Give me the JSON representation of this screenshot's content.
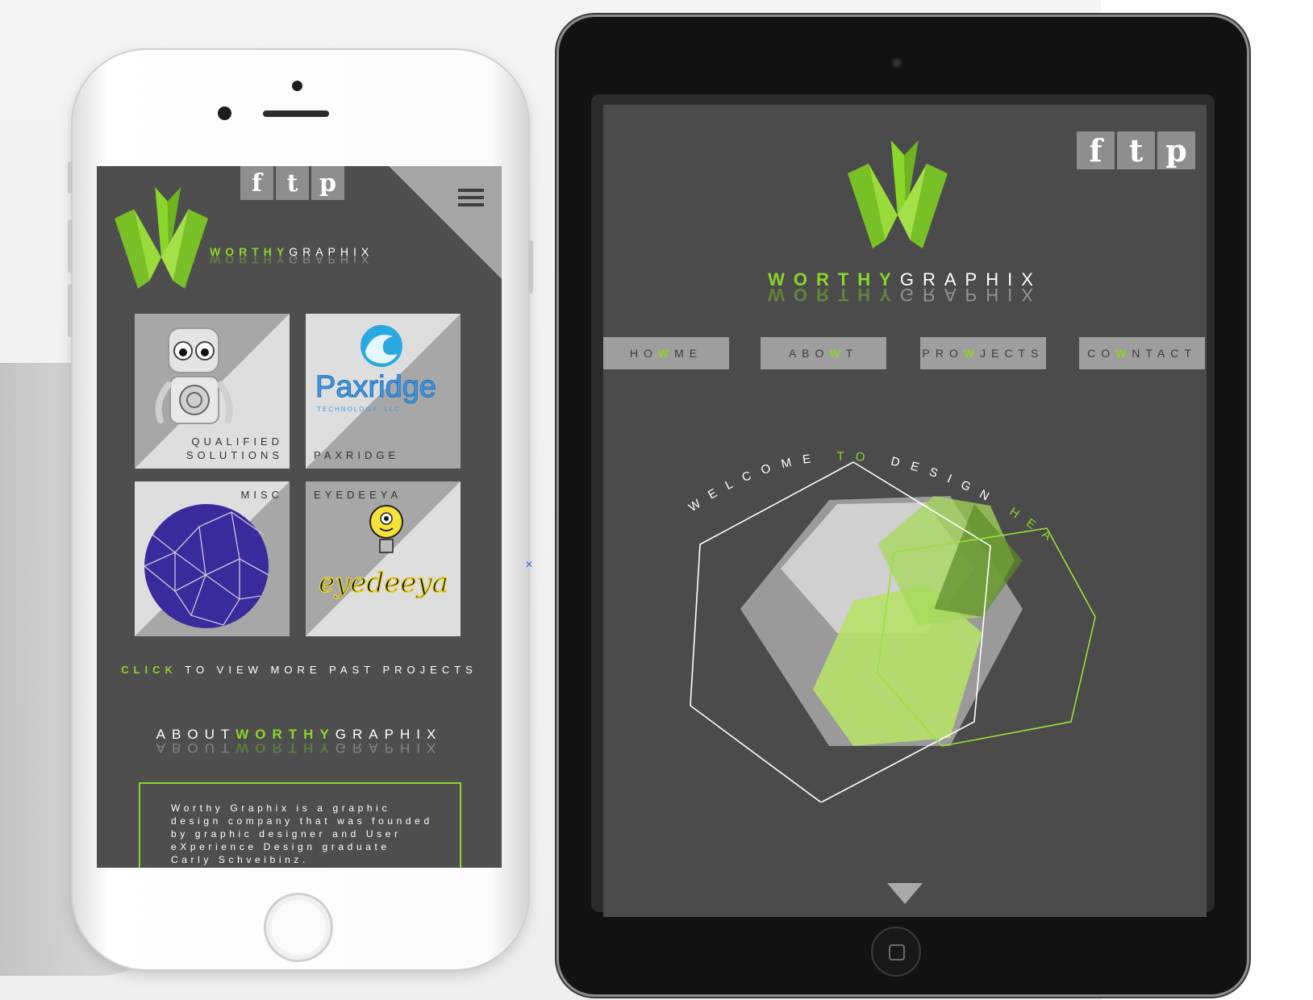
{
  "phone": {
    "social": [
      "f",
      "t",
      "p"
    ],
    "brand": {
      "highlight": "WORTHY",
      "rest": "GRAPHIX"
    },
    "projects": [
      {
        "label_line1": "QUALIFIED",
        "label_line2": "SOLUTIONS"
      },
      {
        "label_line1": "PAXRIDGE",
        "logo_text": "Paxridge",
        "logo_sub": "TECHNOLOGY, LLC"
      },
      {
        "label_line1": "MISC"
      },
      {
        "label_line1": "EYEDEEYA",
        "logo_text": "eyedeeya"
      }
    ],
    "click": {
      "highlight": "CLICK",
      "rest": "TO VIEW MORE PAST PROJECTS"
    },
    "about_heading": {
      "prefix": "ABOUT",
      "highlight": "WORTHY",
      "suffix": "GRAPHIX"
    },
    "about_text": "Worthy Graphix is a graphic design company that was founded by graphic designer and User eXperience Design graduate Carly Schveibinz."
  },
  "tablet": {
    "social": [
      "f",
      "t",
      "p"
    ],
    "brand": {
      "highlight": "WORTHY",
      "rest": "GRAPHIX"
    },
    "nav": [
      {
        "a": "HO",
        "g": "W",
        "b": "ME"
      },
      {
        "a": "ABO",
        "g": "W",
        "b": "T"
      },
      {
        "a": "PRO",
        "g": "W",
        "b": "JECTS"
      },
      {
        "a": "CO",
        "g": "W",
        "b": "NTACT"
      }
    ],
    "hero": {
      "part1": "WELCOME",
      "part2": "TO",
      "part3": "DESIGN",
      "part4": "HEAVEN"
    }
  },
  "colors": {
    "accent": "#8bd62b",
    "screen_bg": "#4e4e4e",
    "tile_gray": "#a7a7a7",
    "nav_gray": "#9e9e9e"
  },
  "icons": [
    "facebook-icon",
    "tumblr-icon",
    "pinterest-icon",
    "hamburger-menu-icon",
    "scroll-down-arrow-icon",
    "close-x-icon"
  ]
}
